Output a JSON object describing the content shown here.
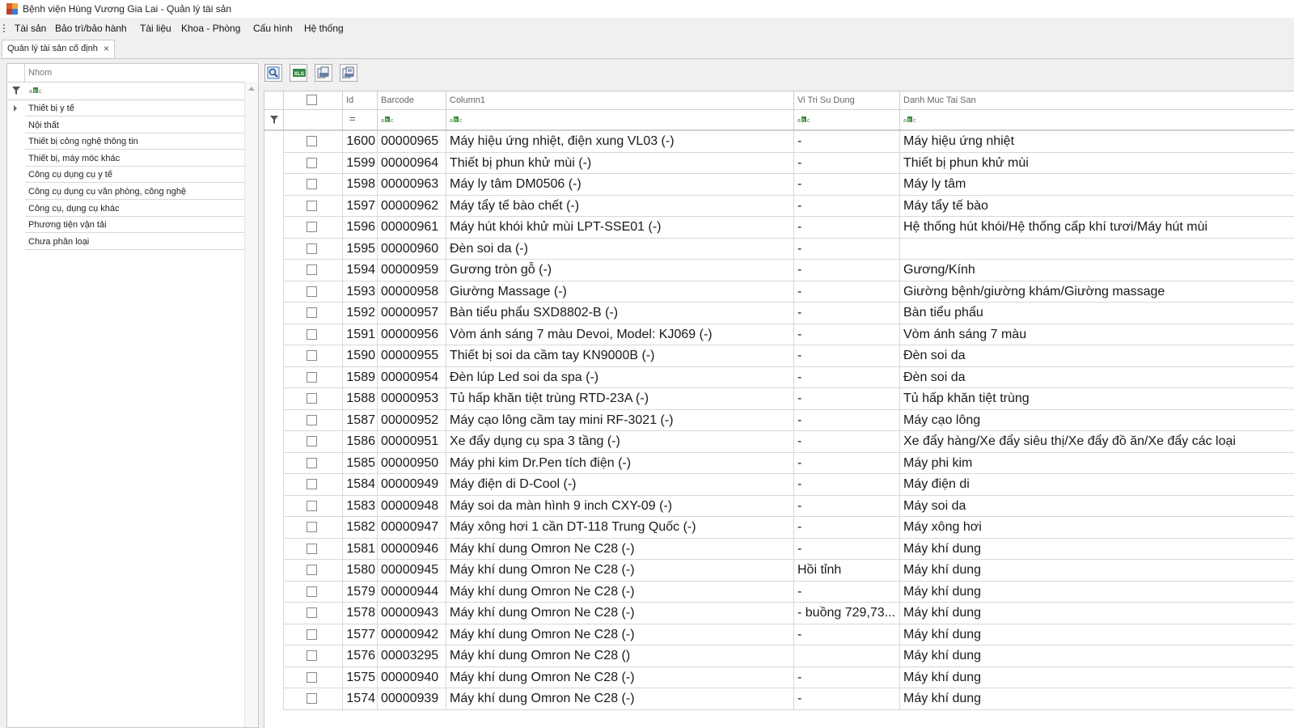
{
  "window": {
    "title": "Bệnh viện Hùng Vương Gia Lai - Quản lý tài sản"
  },
  "menu": [
    "Tài sản",
    "Bảo trì/bảo hành",
    "Tài liệu",
    "Khoa - Phòng",
    "Cấu hình",
    "Hệ thống"
  ],
  "tab": {
    "label": "Quản lý tài sản cố định",
    "close": "×"
  },
  "groups": {
    "header": "Nhom",
    "filter_icon": "abc-filter-icon",
    "items": [
      "Thiết bị y tế",
      "Nội thất",
      "Thiết bị công nghệ thông tin",
      "Thiết bị, máy móc khác",
      "Công cụ dụng cụ y tế",
      "Công cụ dụng cụ văn phòng, công nghệ",
      "Công cụ, dụng cụ khác",
      "Phương tiện vận tải",
      "Chưa phân loại"
    ]
  },
  "toolbar": [
    "search-icon",
    "excel-export-icon",
    "print-icon",
    "print-preview-icon"
  ],
  "grid": {
    "columns": [
      "Id",
      "Barcode",
      "Column1",
      "Vi Tri Su Dung",
      "Danh Muc Tai San"
    ],
    "id_filter": "=",
    "rows": [
      {
        "id": "1600",
        "barcode": "00000965",
        "name": "Máy hiệu ứng nhiệt, điện xung VL03 (-)",
        "loc": "-",
        "cat": "Máy hiệu ứng nhiệt"
      },
      {
        "id": "1599",
        "barcode": "00000964",
        "name": "Thiết bị phun khử mùi (-)",
        "loc": "-",
        "cat": "Thiết bị phun khử mùi"
      },
      {
        "id": "1598",
        "barcode": "00000963",
        "name": "Máy ly tâm DM0506 (-)",
        "loc": "-",
        "cat": "Máy ly tâm"
      },
      {
        "id": "1597",
        "barcode": "00000962",
        "name": "Máy tẩy tế bào chết (-)",
        "loc": "-",
        "cat": "Máy tẩy tế bào"
      },
      {
        "id": "1596",
        "barcode": "00000961",
        "name": "Máy hút khói khử mùi LPT-SSE01 (-)",
        "loc": "-",
        "cat": "Hệ thống hút khói/Hệ thống cấp khí tươi/Máy hút mùi"
      },
      {
        "id": "1595",
        "barcode": "00000960",
        "name": "Đèn soi da  (-)",
        "loc": "-",
        "cat": ""
      },
      {
        "id": "1594",
        "barcode": "00000959",
        "name": "Gương tròn gỗ (-)",
        "loc": "-",
        "cat": "Gương/Kính"
      },
      {
        "id": "1593",
        "barcode": "00000958",
        "name": "Giường Massage (-)",
        "loc": "-",
        "cat": "Giường bệnh/giường khám/Giường massage"
      },
      {
        "id": "1592",
        "barcode": "00000957",
        "name": "Bàn tiểu phẩu SXD8802-B (-)",
        "loc": "-",
        "cat": "Bàn tiểu phẩu"
      },
      {
        "id": "1591",
        "barcode": "00000956",
        "name": "Vòm ánh sáng 7 màu Devoi, Model: KJ069 (-)",
        "loc": "-",
        "cat": "Vòm ánh sáng 7 màu"
      },
      {
        "id": "1590",
        "barcode": "00000955",
        "name": "Thiết bị soi da cầm tay KN9000B (-)",
        "loc": "-",
        "cat": "Đèn soi da"
      },
      {
        "id": "1589",
        "barcode": "00000954",
        "name": "Đèn lúp Led soi da spa (-)",
        "loc": "-",
        "cat": "Đèn soi da"
      },
      {
        "id": "1588",
        "barcode": "00000953",
        "name": "Tủ hấp khăn tiệt trùng RTD-23A (-)",
        "loc": "-",
        "cat": "Tủ hấp khăn tiệt trùng"
      },
      {
        "id": "1587",
        "barcode": "00000952",
        "name": "Máy cạo lông cầm tay mini RF-3021 (-)",
        "loc": "-",
        "cat": "Máy cạo lông"
      },
      {
        "id": "1586",
        "barcode": "00000951",
        "name": "Xe đẩy dụng cụ spa 3 tầng (-)",
        "loc": "-",
        "cat": "Xe đẩy hàng/Xe đẩy siêu thị/Xe đẩy đồ ăn/Xe đẩy các loại"
      },
      {
        "id": "1585",
        "barcode": "00000950",
        "name": "Máy phi kim Dr.Pen tích điện (-)",
        "loc": "-",
        "cat": "Máy phi kim"
      },
      {
        "id": "1584",
        "barcode": "00000949",
        "name": "Máy điện di D-Cool (-)",
        "loc": "-",
        "cat": "Máy điện di"
      },
      {
        "id": "1583",
        "barcode": "00000948",
        "name": "Máy soi da màn hình 9 inch CXY-09 (-)",
        "loc": "-",
        "cat": "Máy soi da"
      },
      {
        "id": "1582",
        "barcode": "00000947",
        "name": "Máy xông hơi 1 cần DT-118 Trung Quốc (-)",
        "loc": "-",
        "cat": "Máy xông hơi"
      },
      {
        "id": "1581",
        "barcode": "00000946",
        "name": "Máy khí dung Omron Ne C28  (-)",
        "loc": "-",
        "cat": "Máy khí dung"
      },
      {
        "id": "1580",
        "barcode": "00000945",
        "name": "Máy khí dung Omron Ne C28  (-)",
        "loc": "Hồi tỉnh",
        "cat": "Máy khí dung"
      },
      {
        "id": "1579",
        "barcode": "00000944",
        "name": "Máy khí dung Omron Ne C28  (-)",
        "loc": "-",
        "cat": "Máy khí dung"
      },
      {
        "id": "1578",
        "barcode": "00000943",
        "name": "Máy khí dung Omron Ne C28  (-)",
        "loc": "- buồng 729,73...",
        "cat": "Máy khí dung"
      },
      {
        "id": "1577",
        "barcode": "00000942",
        "name": "Máy khí dung Omron Ne C28  (-)",
        "loc": "-",
        "cat": "Máy khí dung"
      },
      {
        "id": "1576",
        "barcode": "00003295",
        "name": "Máy khí dung Omron Ne C28  ()",
        "loc": "",
        "cat": "Máy khí dung"
      },
      {
        "id": "1575",
        "barcode": "00000940",
        "name": "Máy khí dung Omron Ne C28  (-)",
        "loc": "-",
        "cat": "Máy khí dung"
      },
      {
        "id": "1574",
        "barcode": "00000939",
        "name": "Máy khí dung Omron Ne C28  (-)",
        "loc": "-",
        "cat": "Máy khí dung"
      }
    ]
  }
}
